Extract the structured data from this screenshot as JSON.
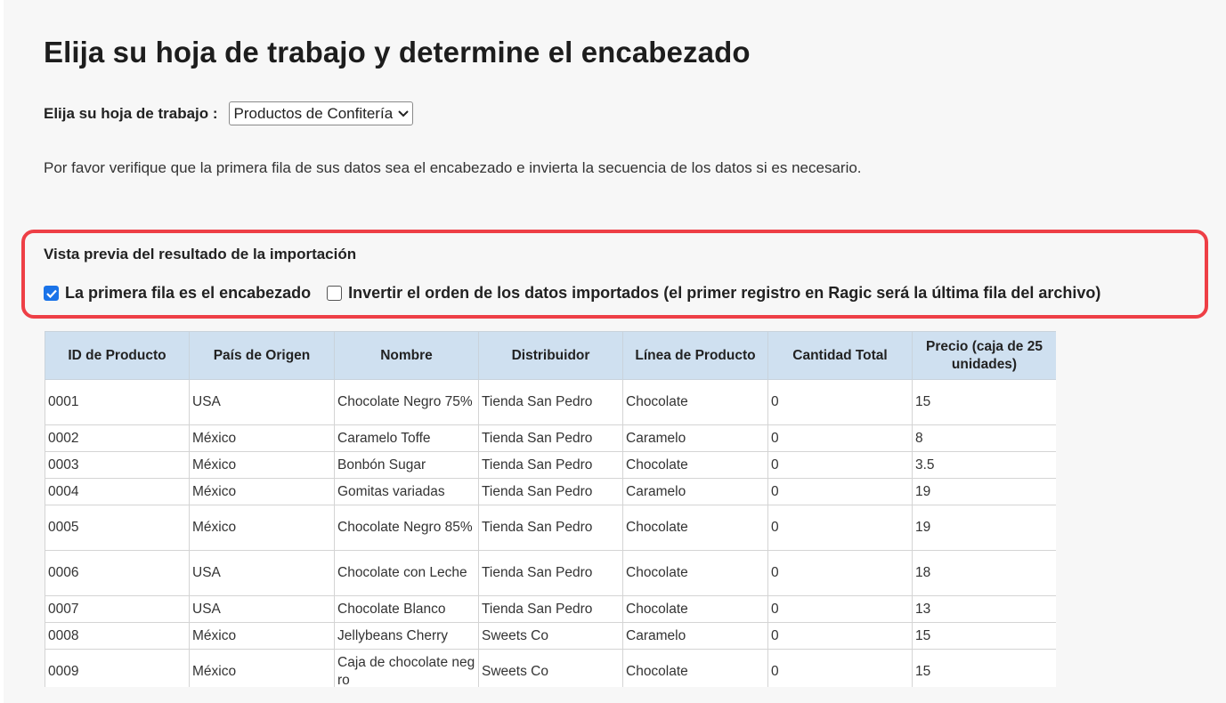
{
  "page": {
    "title": "Elija su hoja de trabajo y determine el encabezado",
    "sheet_label": "Elija su hoja de trabajo :",
    "sheet_selected": "Productos de Confitería",
    "description": "Por favor verifique que la primera fila de sus datos sea el encabezado e invierta la secuencia de los datos si es necesario."
  },
  "preview": {
    "title": "Vista previa del resultado de la importación",
    "option_header": {
      "label": "La primera fila es el encabezado",
      "checked": true
    },
    "option_reverse": {
      "label": "Invertir el orden de los datos importados (el primer registro en Ragic será la última fila del archivo)",
      "checked": false
    }
  },
  "table": {
    "columns": [
      "ID de Producto",
      "País de Origen",
      "Nombre",
      "Distribuidor",
      "Línea de Producto",
      "Cantidad Total",
      "Precio (caja de 25 unidades)"
    ],
    "rows": [
      [
        "0001",
        "USA",
        "Chocolate Negro 75%",
        "Tienda San Pedro",
        "Chocolate",
        "0",
        "15"
      ],
      [
        "0002",
        "México",
        "Caramelo Toffe",
        "Tienda San Pedro",
        "Caramelo",
        "0",
        "8"
      ],
      [
        "0003",
        "México",
        "Bonbón Sugar",
        "Tienda San Pedro",
        "Chocolate",
        "0",
        "3.5"
      ],
      [
        "0004",
        "México",
        "Gomitas variadas",
        "Tienda San Pedro",
        "Caramelo",
        "0",
        "19"
      ],
      [
        "0005",
        "México",
        "Chocolate Negro 85%",
        "Tienda San Pedro",
        "Chocolate",
        "0",
        "19"
      ],
      [
        "0006",
        "USA",
        "Chocolate con Leche",
        "Tienda San Pedro",
        "Chocolate",
        "0",
        "18"
      ],
      [
        "0007",
        "USA",
        "Chocolate Blanco",
        "Tienda San Pedro",
        "Chocolate",
        "0",
        "13"
      ],
      [
        "0008",
        "México",
        "Jellybeans Cherry",
        "Sweets Co",
        "Caramelo",
        "0",
        "15"
      ],
      [
        "0009",
        "México",
        "Caja de chocolate negro",
        "Sweets Co",
        "Chocolate",
        "0",
        "15"
      ]
    ]
  },
  "colors": {
    "highlight_border": "#ee3f46",
    "header_bg": "#cfe0f0",
    "checkbox_on": "#1a73e8"
  }
}
